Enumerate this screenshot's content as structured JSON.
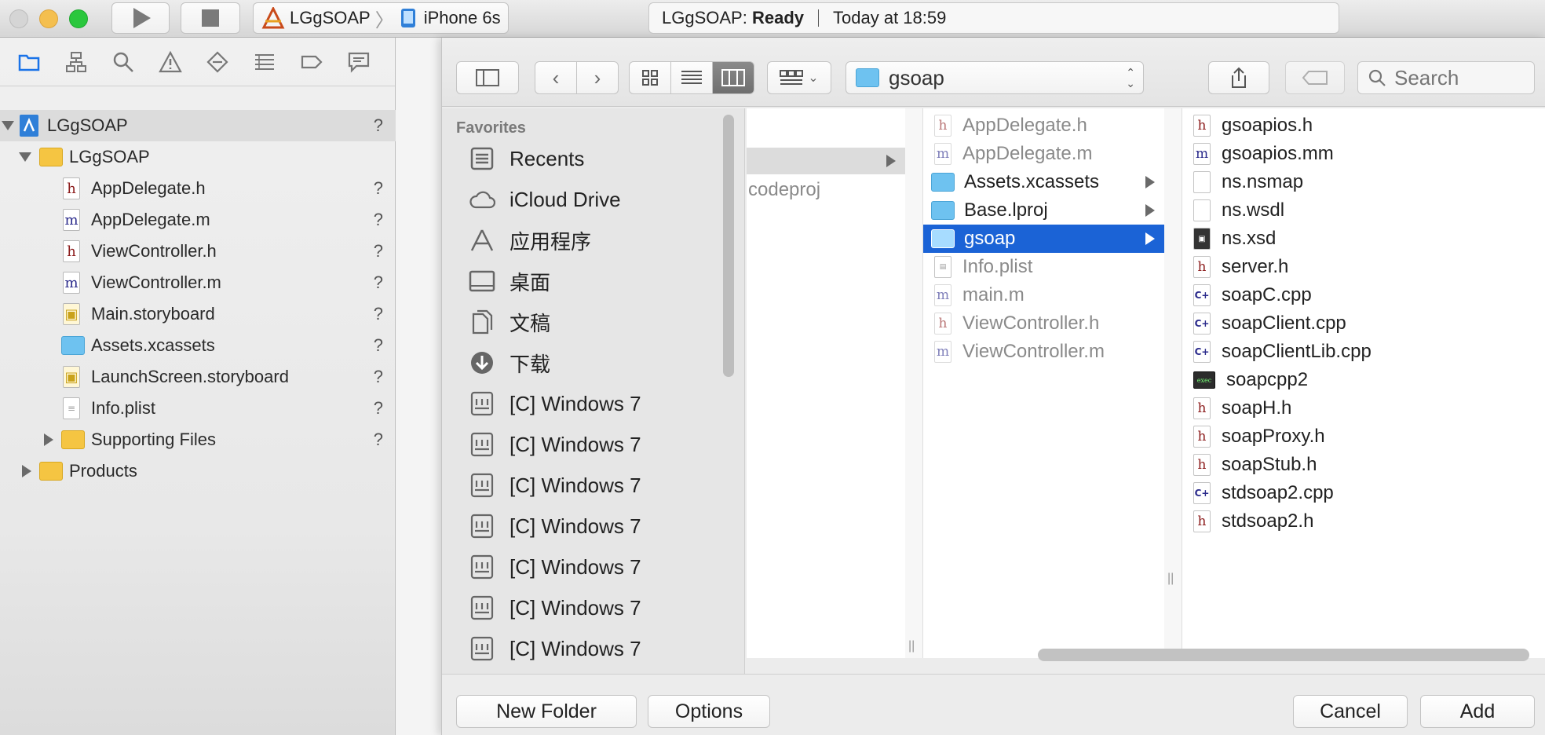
{
  "toolbar": {
    "scheme_project": "LGgSOAP",
    "scheme_device": "iPhone 6s",
    "status_project": "LGgSOAP:",
    "status_state": "Ready",
    "status_time": "Today at 18:59"
  },
  "navigator": {
    "project": "LGgSOAP",
    "group": "LGgSOAP",
    "files": [
      {
        "name": "AppDelegate.h",
        "status": "?"
      },
      {
        "name": "AppDelegate.m",
        "status": "?"
      },
      {
        "name": "ViewController.h",
        "status": "?"
      },
      {
        "name": "ViewController.m",
        "status": "?"
      },
      {
        "name": "Main.storyboard",
        "status": "?"
      },
      {
        "name": "Assets.xcassets",
        "status": "?"
      },
      {
        "name": "LaunchScreen.storyboard",
        "status": "?"
      },
      {
        "name": "Info.plist",
        "status": "?"
      },
      {
        "name": "Supporting Files",
        "status": "?"
      }
    ],
    "project_status": "?",
    "products": "Products"
  },
  "sheet": {
    "path_folder": "gsoap",
    "search_placeholder": "Search",
    "favorites_header": "Favorites",
    "favorites": [
      "Recents",
      "iCloud Drive",
      "应用程序",
      "桌面",
      "文稿",
      "下载",
      "[C] Windows 7",
      "[C] Windows 7",
      "[C] Windows 7",
      "[C] Windows 7",
      "[C] Windows 7",
      "[C] Windows 7",
      "[C] Windows 7"
    ],
    "column1": {
      "partial_item": "codeproj"
    },
    "column2": [
      "AppDelegate.h",
      "AppDelegate.m",
      "Assets.xcassets",
      "Base.lproj",
      "gsoap",
      "Info.plist",
      "main.m",
      "ViewController.h",
      "ViewController.m"
    ],
    "column3": [
      "gsoapios.h",
      "gsoapios.mm",
      "ns.nsmap",
      "ns.wsdl",
      "ns.xsd",
      "server.h",
      "soapC.cpp",
      "soapClient.cpp",
      "soapClientLib.cpp",
      "soapcpp2",
      "soapH.h",
      "soapProxy.h",
      "soapStub.h",
      "stdsoap2.cpp",
      "stdsoap2.h"
    ],
    "buttons": {
      "new_folder": "New Folder",
      "options": "Options",
      "cancel": "Cancel",
      "add": "Add"
    }
  },
  "colors": {
    "selection": "#1b63d6",
    "folder_blue": "#6ec2f0",
    "folder_yellow": "#f5c542"
  }
}
